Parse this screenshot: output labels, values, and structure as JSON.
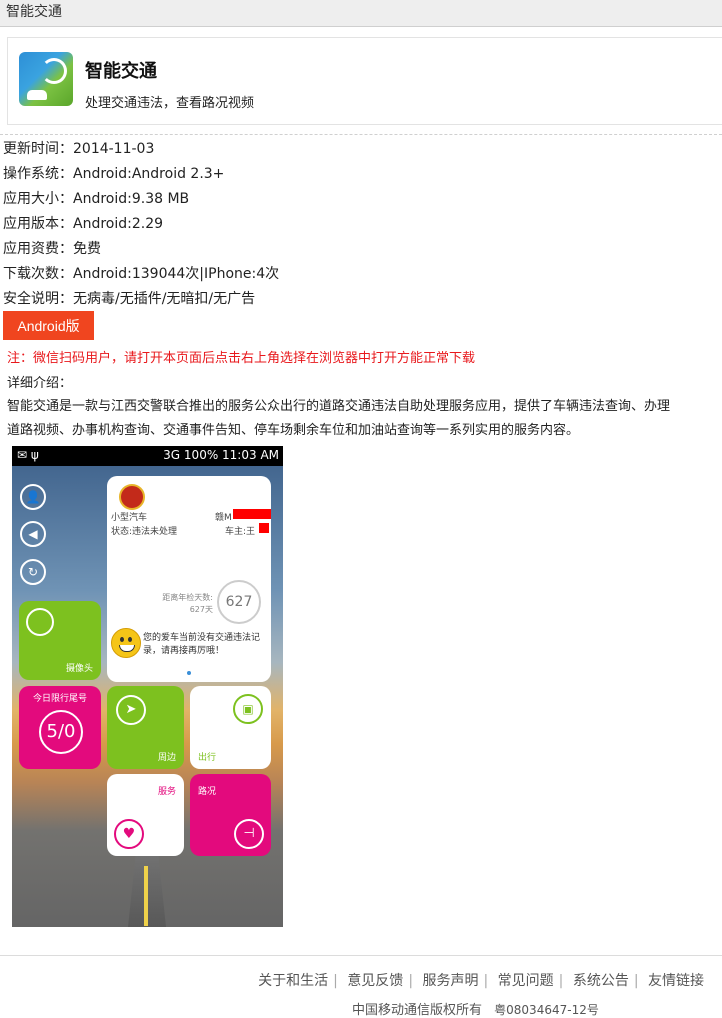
{
  "topbar": {
    "title": "智能交通"
  },
  "app": {
    "name": "智能交通",
    "tagline": "处理交通违法，查看路况视频"
  },
  "info_rows": [
    "更新时间：2014-11-03",
    "操作系统：Android:Android 2.3+",
    "应用大小：Android:9.38 MB",
    "应用版本：Android:2.29",
    "应用资费：免费",
    "下载次数：Android:139044次|IPhone:4次",
    "安全说明：无病毒/无插件/无暗扣/无广告"
  ],
  "download_button": "Android版",
  "note": "注：微信扫码用户，请打开本页面后点击右上角选择在浏览器中打开方能正常下载",
  "detail": {
    "title": "详细介绍：",
    "line1": "智能交通是一款与江西交警联合推出的服务公众出行的道路交通违法自助处理服务应用，提供了车辆违法查询、办理",
    "line2": "道路视频、办事机构查询、交通事件告知、停车场剩余车位和加油站查询等一系列实用的服务内容。"
  },
  "screenshot": {
    "status_left": "✉ ψ",
    "status_right": "3G 100% 11:03 AM",
    "car_type": "小型汽车",
    "plate_prefix": "赣M",
    "status_text": "状态:违法未处理",
    "owner_prefix": "车主:王",
    "days_label": "距离年检天数:",
    "days_sub": "627天",
    "days_value": "627",
    "message": "您的爱车当前没有交通违法记录，请再接再厉哦！",
    "tile_camera": "摄像头",
    "tile_limit_title": "今日限行尾号",
    "tile_limit_value": "5/0",
    "tile_nearby": "周边",
    "tile_trip": "出行",
    "tile_service": "服务",
    "tile_road": "路况"
  },
  "footer": {
    "links": [
      "关于和生活",
      "意见反馈",
      "服务声明",
      "常见问题",
      "系统公告",
      "友情链接"
    ],
    "copyright": "中国移动通信版权所有",
    "icp": "粤08034647-12号"
  }
}
